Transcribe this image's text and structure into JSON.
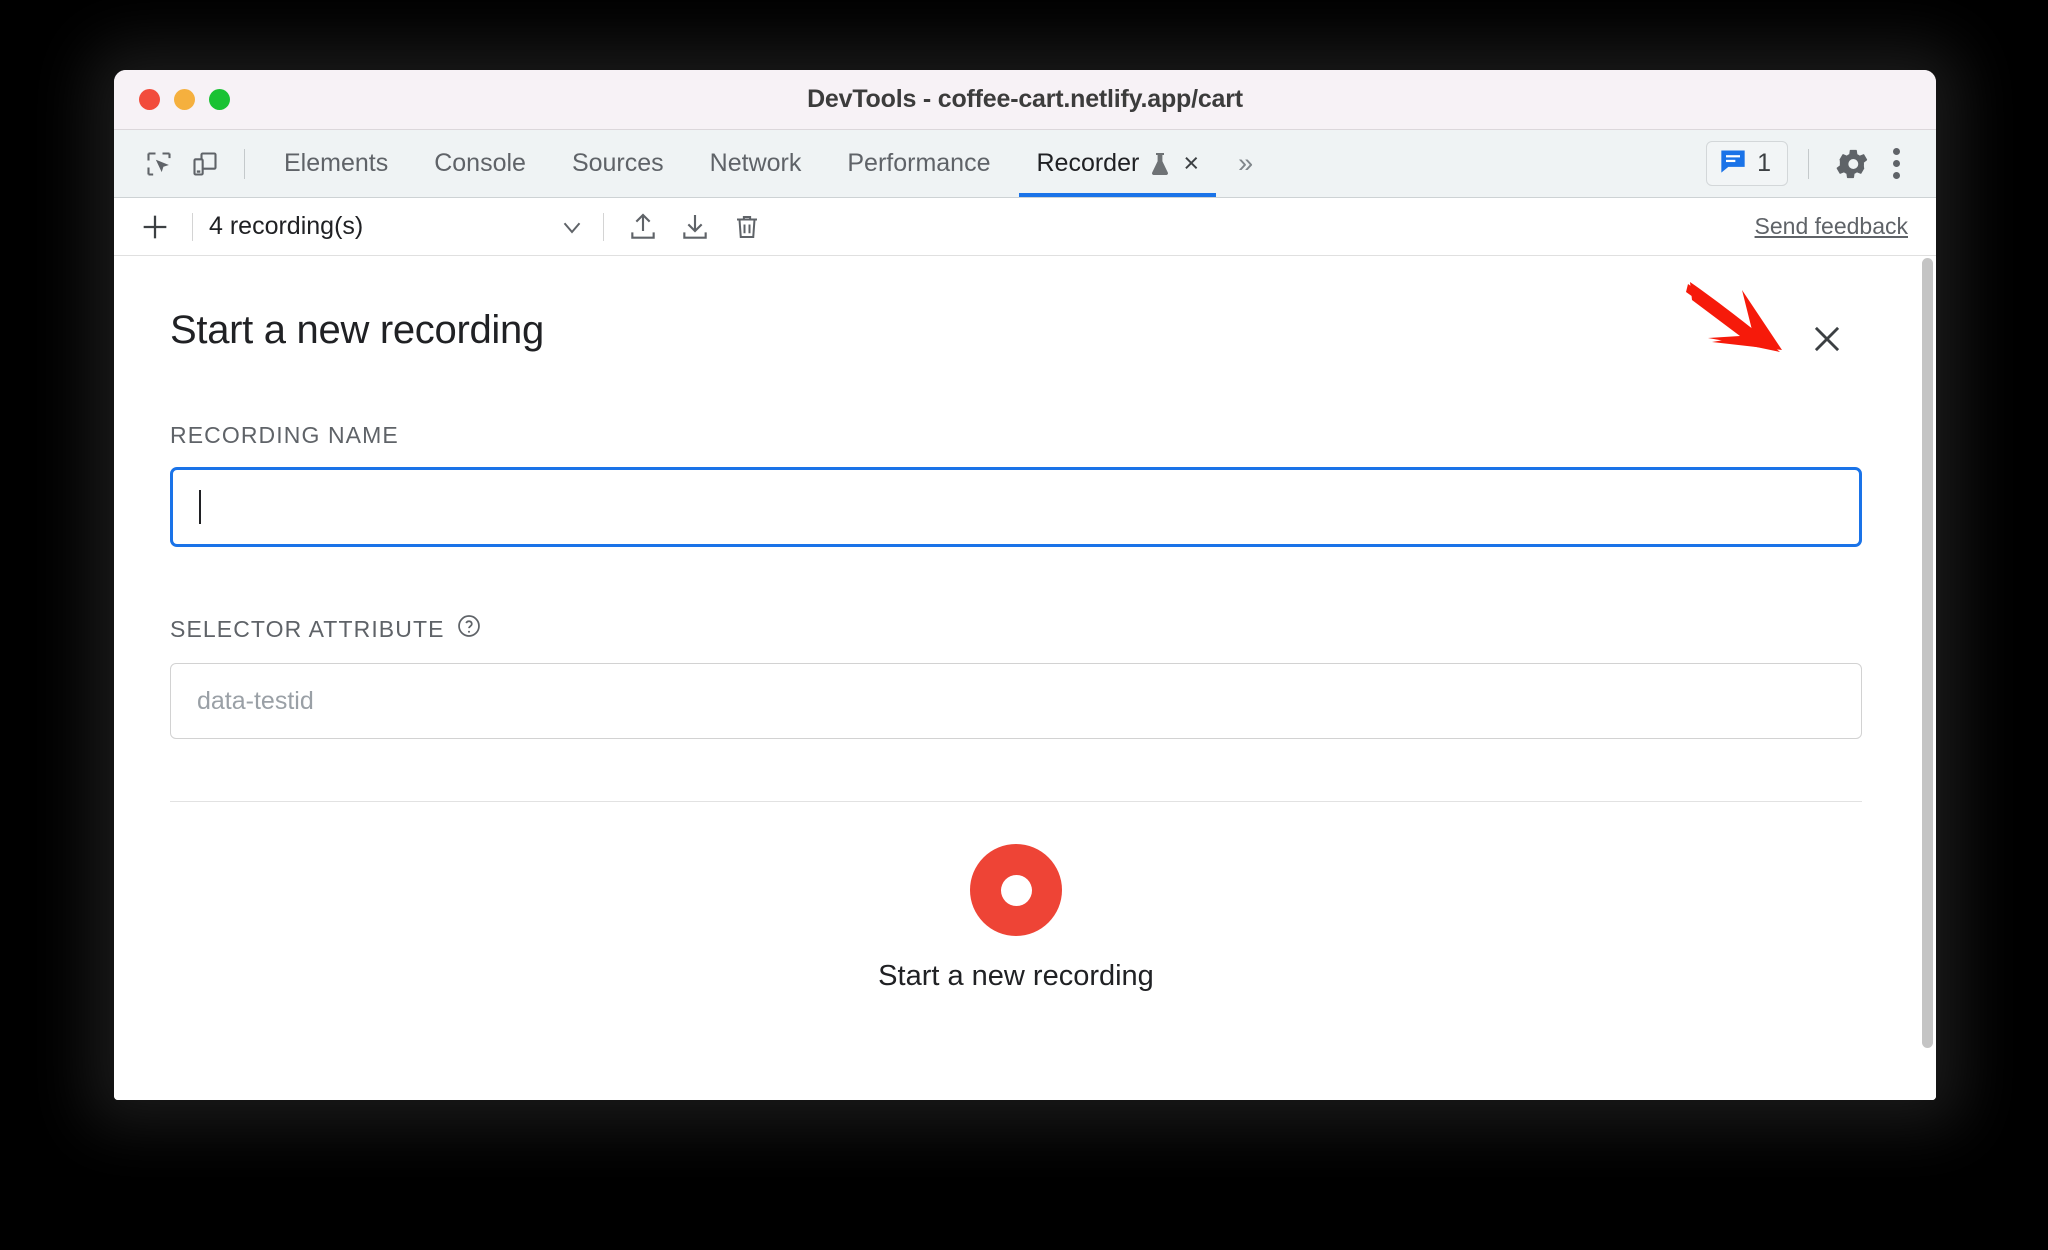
{
  "window": {
    "title": "DevTools - coffee-cart.netlify.app/cart",
    "traffic_lights": [
      "close",
      "minimize",
      "zoom"
    ],
    "colors": {
      "close": "#f24c3c",
      "minimize": "#f5b03e",
      "zoom": "#19c233",
      "accent": "#1a73e8",
      "record": "#ee4436",
      "annotation_arrow": "#f61a0a"
    }
  },
  "devtools_tabs": {
    "left_icons": [
      {
        "name": "inspect-element-icon",
        "label": "Inspect element"
      },
      {
        "name": "device-toolbar-icon",
        "label": "Toggle device toolbar"
      }
    ],
    "items": [
      {
        "label": "Elements",
        "active": false
      },
      {
        "label": "Console",
        "active": false
      },
      {
        "label": "Sources",
        "active": false
      },
      {
        "label": "Network",
        "active": false
      },
      {
        "label": "Performance",
        "active": false
      },
      {
        "label": "Recorder",
        "active": true,
        "experimental": true,
        "closable": true
      }
    ],
    "overflow_label": "»",
    "tab_close_label": "×",
    "right": {
      "messages_count": "1",
      "settings_label": "Settings",
      "more_label": "Customize and control DevTools"
    }
  },
  "recorder_toolbar": {
    "add_label": "+",
    "recordings_select_value": "4 recording(s)",
    "import_label": "Import recording",
    "export_label": "Export recording",
    "delete_label": "Delete recording",
    "feedback_label": "Send feedback"
  },
  "panel": {
    "title": "Start a new recording",
    "close_label": "×",
    "fields": [
      {
        "label": "RECORDING NAME",
        "value": "",
        "placeholder": "",
        "focused": true,
        "help": false
      },
      {
        "label": "SELECTOR ATTRIBUTE",
        "value": "",
        "placeholder": "data-testid",
        "focused": false,
        "help": true,
        "help_label": "?"
      }
    ],
    "submit": {
      "label": "Start a new recording",
      "icon": "record-circle-icon"
    }
  }
}
